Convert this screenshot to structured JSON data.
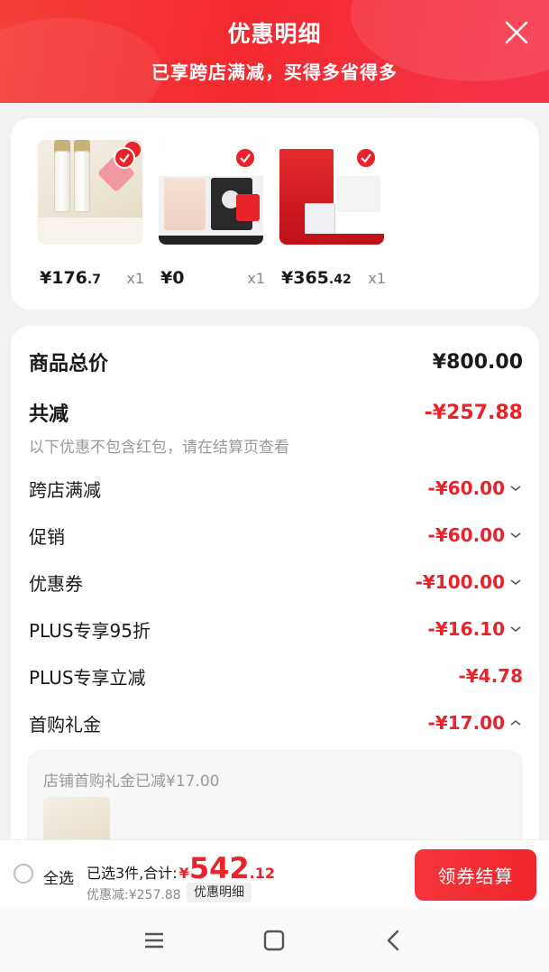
{
  "header": {
    "title": "优惠明细",
    "subtitle": "已享跨店满减，买得多省得多"
  },
  "products": [
    {
      "price_int": "¥176",
      "price_dec": ".7",
      "qty": "x1"
    },
    {
      "price_int": "¥0",
      "price_dec": "",
      "qty": "x1"
    },
    {
      "price_int": "¥365",
      "price_dec": ".42",
      "qty": "x1"
    }
  ],
  "summary": {
    "total_label": "商品总价",
    "total_amount": "¥800.00",
    "reduce_label": "共减",
    "reduce_amount": "-¥257.88",
    "note": "以下优惠不包含红包，请在结算页查看",
    "items": [
      {
        "label": "跨店满减",
        "amount": "-¥60.00"
      },
      {
        "label": "促销",
        "amount": "-¥60.00"
      },
      {
        "label": "优惠券",
        "amount": "-¥100.00"
      },
      {
        "label": "PLUS专享95折",
        "amount": "-¥16.10"
      },
      {
        "label": "PLUS专享立减",
        "amount": "-¥4.78"
      },
      {
        "label": "首购礼金",
        "amount": "-¥17.00"
      }
    ],
    "gift_text": "店铺首购礼金已减¥17.00"
  },
  "bottom": {
    "select_all": "全选",
    "selected_prefix": "已选3件,合计:",
    "currency": "¥",
    "total_int": "542",
    "total_dec": ".12",
    "saved": "优惠减:¥257.88",
    "detail_button": "优惠明细",
    "checkout": "领券结算"
  },
  "colors": {
    "accent": "#e8232a",
    "header": "#f3292f"
  }
}
